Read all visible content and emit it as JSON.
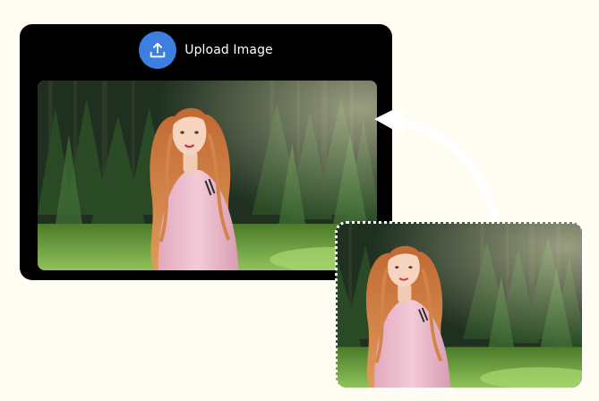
{
  "upload": {
    "label": "Upload Image",
    "icon": "upload-icon"
  },
  "photo_main": {
    "subject": "girl-in-pink-sweater-forest-photo"
  },
  "photo_small": {
    "subject": "girl-in-pink-sweater-forest-thumbnail"
  },
  "colors": {
    "page_background": "#fffcf2",
    "card_background": "#000000",
    "upload_button": "#3d7fe0",
    "arrow": "#ffffff",
    "sweater": "#e8b8c8",
    "hair": "#b45a2a"
  }
}
